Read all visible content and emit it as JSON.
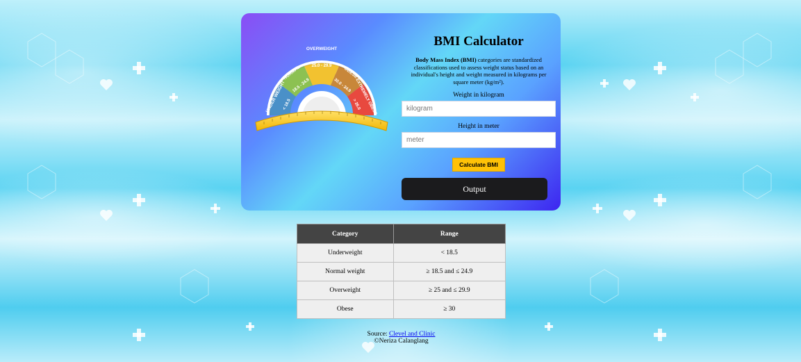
{
  "calculator": {
    "title": "BMI Calculator",
    "description_bold": "Body Mass Index (BMI)",
    "description_rest": " categories are standardized classifications used to assess weight status based on an individual's height and weight measured in kilograms per square meter (kg/m²).",
    "weight_label": "Weight in kilogram",
    "weight_placeholder": "kilogram",
    "weight_value": "",
    "height_label": "Height in meter",
    "height_placeholder": "meter",
    "height_value": "",
    "calculate_label": "Calculate BMI",
    "output_label": "Output"
  },
  "gauge": {
    "segments": [
      {
        "name": "UNDER WEIGHT",
        "range": "< 18.5",
        "color": "#4a90c8"
      },
      {
        "name": "NORMAL",
        "range": "18.5 - 24.9",
        "color": "#8cc152"
      },
      {
        "name": "OVERWEIGHT",
        "range": "25.0 - 29.9",
        "color": "#f2c230"
      },
      {
        "name": "OBESE",
        "range": "30.0 - 34.9",
        "color": "#e9893a"
      },
      {
        "name": "EXTREMELY OBESE",
        "range": "> 35.0",
        "color": "#e8493f"
      }
    ]
  },
  "table": {
    "headers": [
      "Category",
      "Range"
    ],
    "rows": [
      [
        "Underweight",
        "< 18.5"
      ],
      [
        "Normal weight",
        "≥ 18.5 and ≤ 24.9"
      ],
      [
        "Overweight",
        "≥ 25 and ≤ 29.9"
      ],
      [
        "Obese",
        "≥ 30"
      ]
    ]
  },
  "footer": {
    "source_prefix": "Source: ",
    "source_link": "Clevel and Clinic",
    "credit": "©Neriza Calanglang"
  },
  "colors": {
    "card_start": "#8a4df5",
    "card_end": "#3d25f0",
    "button": "#ffc107",
    "output_bg": "#1b1b1d",
    "table_header": "#444444"
  }
}
